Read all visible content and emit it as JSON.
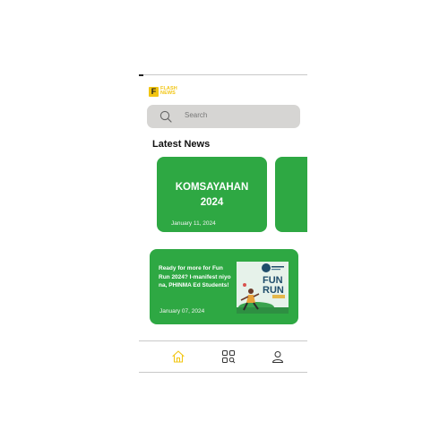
{
  "app": {
    "logo_letter": "F",
    "logo_line1": "FLASH",
    "logo_line2": "NEWS"
  },
  "search": {
    "placeholder": "Search",
    "icon": "search-icon"
  },
  "section": {
    "title": "Latest News"
  },
  "cards": [
    {
      "title_line1": "KOMSAYAHAN",
      "title_line2": "2024",
      "date": "January 11, 2024"
    },
    {
      "title": "Ready for more for Fun Run 2024? I-manifest niyo na, PHINMA Ed Students!",
      "date": "January 07, 2024",
      "poster_text": "FUN RUN"
    }
  ],
  "nav": {
    "items": [
      {
        "icon": "home-icon",
        "active": true
      },
      {
        "icon": "explore-icon",
        "active": false
      },
      {
        "icon": "profile-icon",
        "active": false
      }
    ]
  },
  "colors": {
    "card_green": "#2ea843",
    "accent_yellow": "#f2c511",
    "search_bg": "#d6d5d3"
  }
}
